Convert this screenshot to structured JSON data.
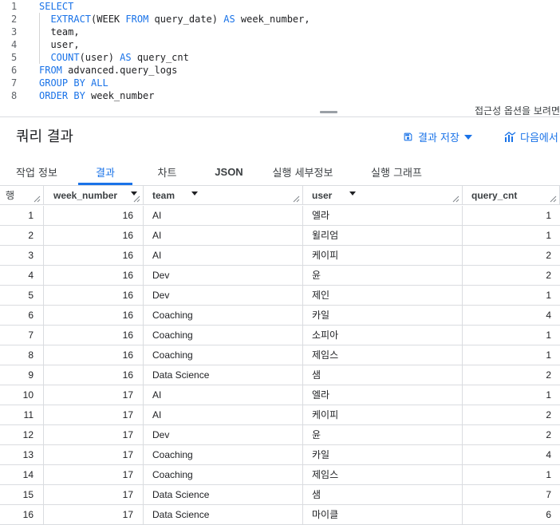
{
  "editor": {
    "lines": [
      {
        "n": "1",
        "parts": [
          {
            "t": "SELECT",
            "k": true
          }
        ]
      },
      {
        "n": "2",
        "parts": [
          {
            "t": "  ",
            "k": false
          },
          {
            "t": "EXTRACT",
            "k": true
          },
          {
            "t": "(WEEK ",
            "k": false
          },
          {
            "t": "FROM",
            "k": true
          },
          {
            "t": " query_date) ",
            "k": false
          },
          {
            "t": "AS",
            "k": true
          },
          {
            "t": " week_number,",
            "k": false
          }
        ]
      },
      {
        "n": "3",
        "parts": [
          {
            "t": "  team,",
            "k": false
          }
        ]
      },
      {
        "n": "4",
        "parts": [
          {
            "t": "  user,",
            "k": false
          }
        ]
      },
      {
        "n": "5",
        "parts": [
          {
            "t": "  ",
            "k": false
          },
          {
            "t": "COUNT",
            "k": true
          },
          {
            "t": "(user) ",
            "k": false
          },
          {
            "t": "AS",
            "k": true
          },
          {
            "t": " query_cnt",
            "k": false
          }
        ]
      },
      {
        "n": "6",
        "parts": [
          {
            "t": "FROM",
            "k": true
          },
          {
            "t": " advanced.query_logs",
            "k": false
          }
        ]
      },
      {
        "n": "7",
        "parts": [
          {
            "t": "GROUP BY ALL",
            "k": true
          }
        ]
      },
      {
        "n": "8",
        "parts": [
          {
            "t": "ORDER BY",
            "k": true
          },
          {
            "t": " week_number",
            "k": false
          }
        ]
      }
    ],
    "shortcut_hint": "접근성 옵션을 보려면"
  },
  "results": {
    "title": "쿼리 결과",
    "save_label": "결과 저장",
    "explore_label": "다음에서"
  },
  "tabs": [
    {
      "label": "작업 정보",
      "active": false,
      "bold": false
    },
    {
      "label": "결과",
      "active": true,
      "bold": false
    },
    {
      "label": "차트",
      "active": false,
      "bold": false
    },
    {
      "label": "JSON",
      "active": false,
      "bold": true
    },
    {
      "label": "실행 세부정보",
      "active": false,
      "bold": false
    },
    {
      "label": "실행 그래프",
      "active": false,
      "bold": false
    }
  ],
  "table": {
    "columns": [
      {
        "key": "row",
        "label": "행"
      },
      {
        "key": "week_number",
        "label": "week_number"
      },
      {
        "key": "team",
        "label": "team"
      },
      {
        "key": "user",
        "label": "user"
      },
      {
        "key": "query_cnt",
        "label": "query_cnt"
      }
    ],
    "rows": [
      [
        "1",
        "16",
        "AI",
        "엘라",
        "1"
      ],
      [
        "2",
        "16",
        "AI",
        "윌리엄",
        "1"
      ],
      [
        "3",
        "16",
        "AI",
        "케이피",
        "2"
      ],
      [
        "4",
        "16",
        "Dev",
        "윤",
        "2"
      ],
      [
        "5",
        "16",
        "Dev",
        "제인",
        "1"
      ],
      [
        "6",
        "16",
        "Coaching",
        "카일",
        "4"
      ],
      [
        "7",
        "16",
        "Coaching",
        "소피아",
        "1"
      ],
      [
        "8",
        "16",
        "Coaching",
        "제임스",
        "1"
      ],
      [
        "9",
        "16",
        "Data Science",
        "샘",
        "2"
      ],
      [
        "10",
        "17",
        "AI",
        "엘라",
        "1"
      ],
      [
        "11",
        "17",
        "AI",
        "케이피",
        "2"
      ],
      [
        "12",
        "17",
        "Dev",
        "윤",
        "2"
      ],
      [
        "13",
        "17",
        "Coaching",
        "카일",
        "4"
      ],
      [
        "14",
        "17",
        "Coaching",
        "제임스",
        "1"
      ],
      [
        "15",
        "17",
        "Data Science",
        "샘",
        "7"
      ],
      [
        "16",
        "17",
        "Data Science",
        "마이클",
        "6"
      ]
    ]
  },
  "colors": {
    "accent": "#1a73e8",
    "keyword": "#1a73e8",
    "divider": "#dadce0"
  },
  "icons": {
    "save": "save-icon",
    "dropdown": "arrow-drop-down-icon",
    "explore": "chart-icon",
    "sort": "sort-arrow-icon",
    "resize": "column-resize-icon"
  }
}
